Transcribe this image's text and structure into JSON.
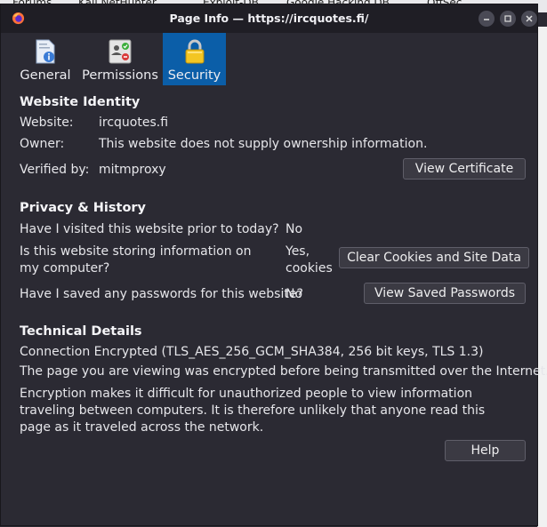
{
  "background_tabs": [
    "Forums",
    "Kali NetHunter",
    "Exploit-DB",
    "Google Hacking DB",
    "OffSec"
  ],
  "window": {
    "title": "Page Info — https://ircquotes.fi/"
  },
  "tabs": [
    {
      "label": "General",
      "icon": "info-page-icon"
    },
    {
      "label": "Permissions",
      "icon": "permissions-icon"
    },
    {
      "label": "Security",
      "icon": "lock-icon",
      "active": true
    }
  ],
  "identity": {
    "heading": "Website Identity",
    "website_label": "Website:",
    "website_value": "ircquotes.fi",
    "owner_label": "Owner:",
    "owner_value": "This website does not supply ownership information.",
    "verified_label": "Verified by:",
    "verified_value": "mitmproxy",
    "view_cert_button": "View Certificate"
  },
  "privacy": {
    "heading": "Privacy & History",
    "visited_q": "Have I visited this website prior to today?",
    "visited_a": "No",
    "storing_q": "Is this website storing information on my computer?",
    "storing_a": "Yes, cookies",
    "clear_button": "Clear Cookies and Site Data",
    "passwords_q": "Have I saved any passwords for this website?",
    "passwords_a": "No",
    "view_passwords_button": "View Saved Passwords"
  },
  "technical": {
    "heading": "Technical Details",
    "connection": "Connection Encrypted (TLS_AES_256_GCM_SHA384, 256 bit keys, TLS 1.3)",
    "line1": "The page you are viewing was encrypted before being transmitted over the Internet.",
    "line2": "Encryption makes it difficult for unauthorized people to view information traveling between computers. It is therefore unlikely that anyone read this page as it traveled across the network."
  },
  "help_button": "Help"
}
